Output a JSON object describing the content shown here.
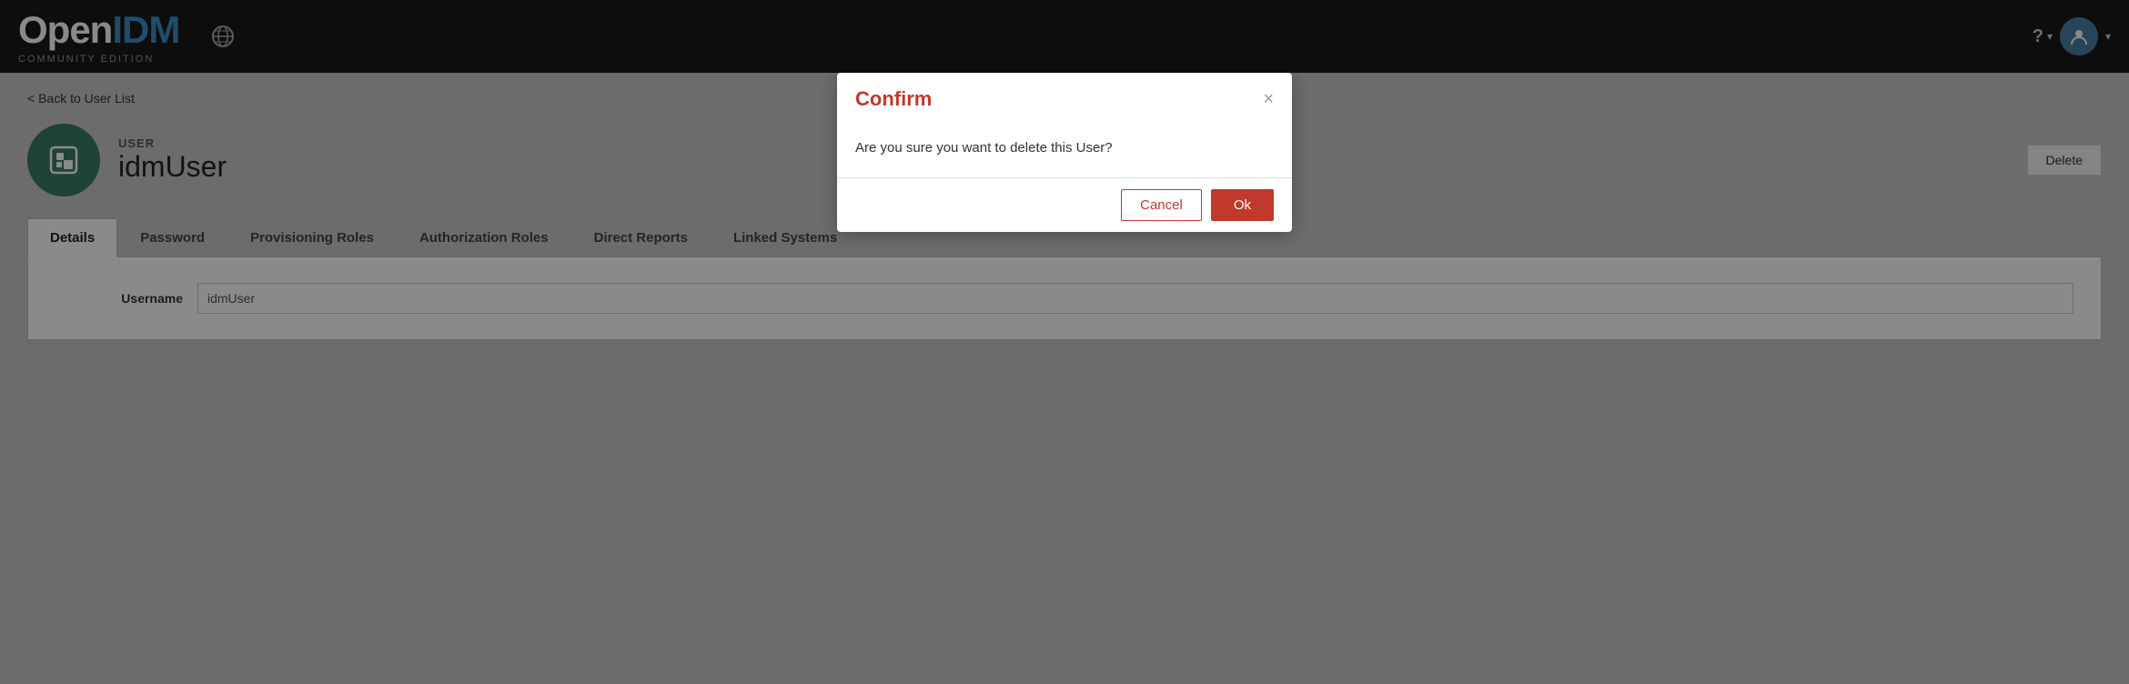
{
  "app": {
    "logo_open": "Open",
    "logo_idm": "IDM",
    "logo_subtitle": "COMMUNITY EDITION"
  },
  "navbar": {
    "world_icon": "🌐",
    "help_label": "?",
    "user_icon": "👤",
    "chevron": "▾"
  },
  "page": {
    "back_label": "< Back to User List",
    "user_section_label": "USER",
    "username_display": "idmUser",
    "delete_button_label": "Delete"
  },
  "tabs": [
    {
      "id": "details",
      "label": "Details",
      "active": true
    },
    {
      "id": "password",
      "label": "Password",
      "active": false
    },
    {
      "id": "provisioning-roles",
      "label": "Provisioning Roles",
      "active": false
    },
    {
      "id": "authorization-roles",
      "label": "Authorization Roles",
      "active": false
    },
    {
      "id": "direct-reports",
      "label": "Direct Reports",
      "active": false
    },
    {
      "id": "linked-systems",
      "label": "Linked Systems",
      "active": false
    }
  ],
  "form": {
    "username_label": "Username",
    "username_value": "idmUser"
  },
  "modal": {
    "title": "Confirm",
    "message": "Are you sure you want to delete this User?",
    "cancel_label": "Cancel",
    "ok_label": "Ok",
    "close_symbol": "×"
  }
}
